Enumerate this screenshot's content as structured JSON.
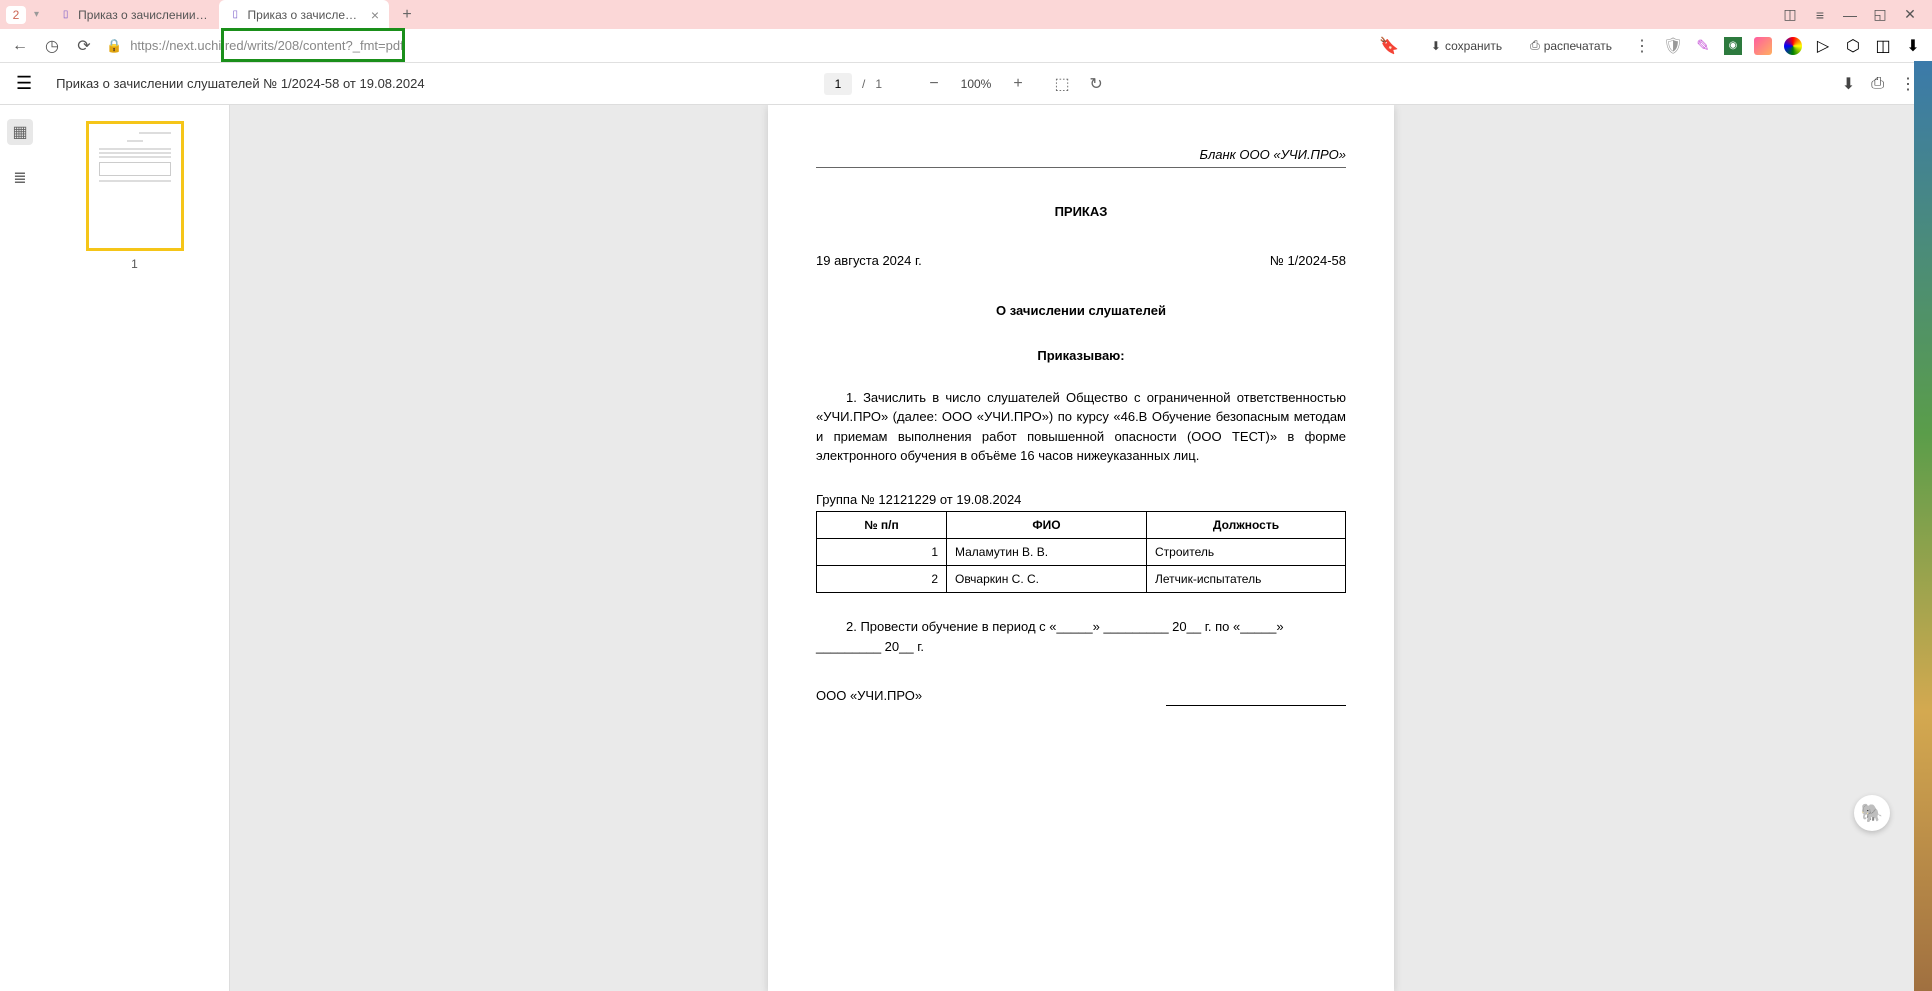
{
  "browser": {
    "tab_count": "2",
    "tabs": [
      {
        "title": "Приказ о зачислении слу",
        "active": false
      },
      {
        "title": "Приказ о зачислении с",
        "active": true
      }
    ],
    "url": "https://next.uchi.red/writs/208/content?_fmt=pdf",
    "actions": {
      "save": "сохранить",
      "print": "распечатать"
    }
  },
  "pdf_viewer": {
    "title": "Приказ о зачислении слушателей № 1/2024-58 от 19.08.2024",
    "current_page": "1",
    "total_pages": "1",
    "zoom": "100%",
    "thumb_label": "1"
  },
  "document": {
    "blank": "Бланк ООО «УЧИ.ПРО»",
    "heading": "ПРИКАЗ",
    "date": "19 августа 2024 г.",
    "number": "№ 1/2024-58",
    "subject": "О зачислении слушателей",
    "command": "Приказываю:",
    "paragraph1": "1.  Зачислить  в число  слушателей  Общество с ограниченной  ответственностью  «УЧИ.ПРО»  (далее: ООО   «УЧИ.ПРО»)   по курсу  «46.В  Обучение   безопасным   методам   и  приемам   выполнения   работ повышенной опасности (ООО ТЕСТ)» в форме электронного обучения в объёме 16 часов нижеуказанных лиц.",
    "group_line": "Группа № 12121229 от 19.08.2024",
    "table": {
      "headers": {
        "col1": "№ п/п",
        "col2": "ФИО",
        "col3": "Должность"
      },
      "rows": [
        {
          "num": "1",
          "name": "Маламутин В. В.",
          "position": "Строитель"
        },
        {
          "num": "2",
          "name": "Овчаркин С. С.",
          "position": "Летчик-испытатель"
        }
      ]
    },
    "paragraph2": "2.  Провести обучение в период с «_____» _________ 20__ г. по «_____» _________ 20__ г.",
    "signer": "ООО «УЧИ.ПРО»"
  }
}
